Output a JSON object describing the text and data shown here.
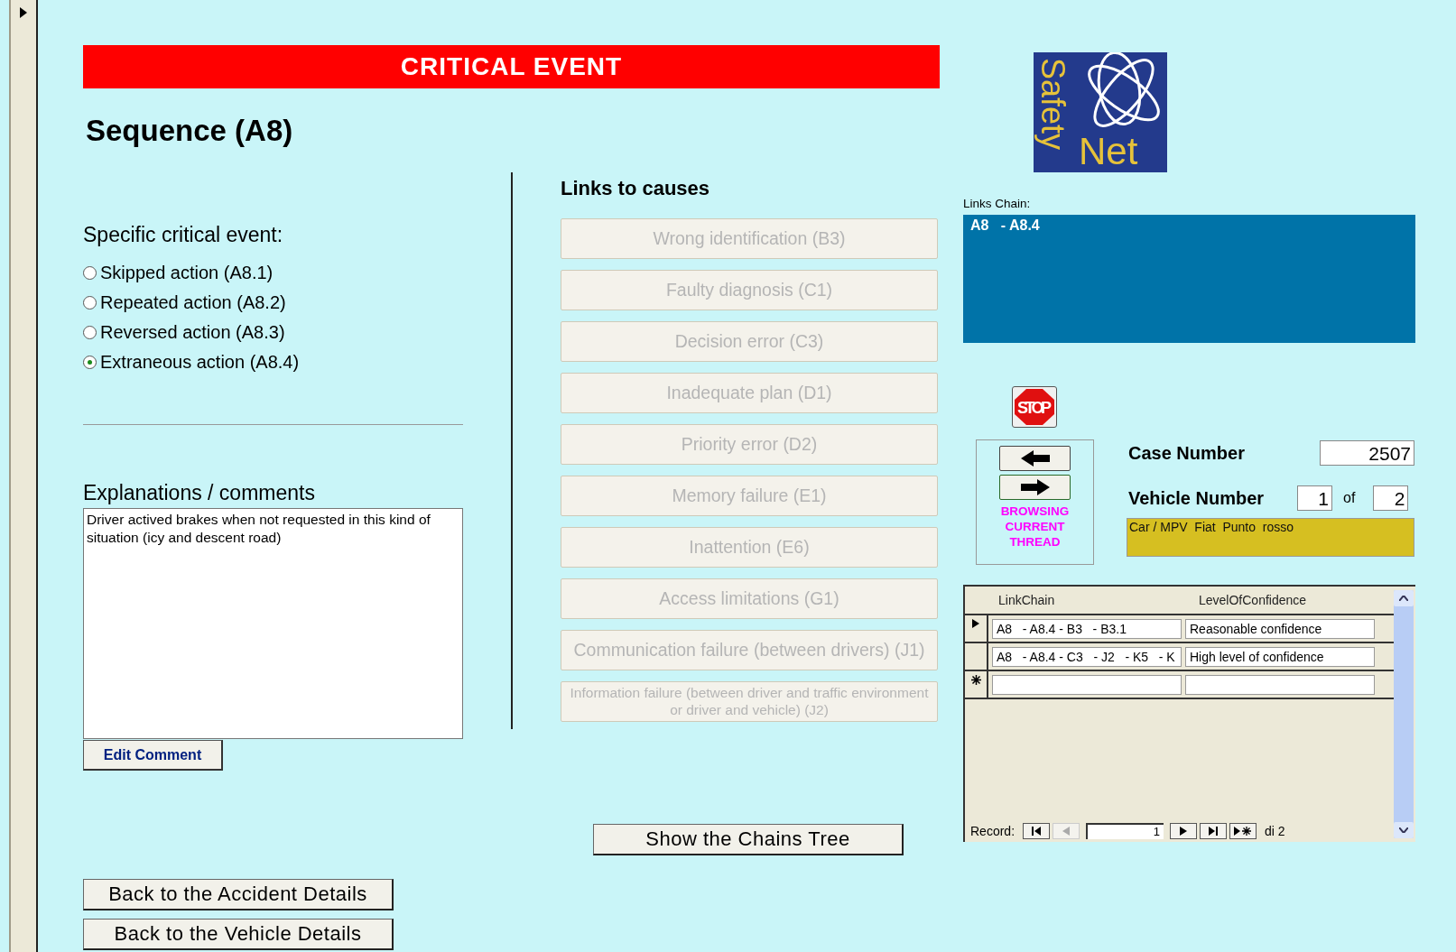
{
  "banner": {
    "title": "CRITICAL EVENT"
  },
  "heading": "Sequence (A8)",
  "logo": {
    "word_1": "Safety",
    "word_2": "Net"
  },
  "specific_event": {
    "label": "Specific critical event:",
    "options": [
      {
        "label": "Skipped action (A8.1)",
        "selected": false
      },
      {
        "label": "Repeated action (A8.2)",
        "selected": false
      },
      {
        "label": "Reversed action (A8.3)",
        "selected": false
      },
      {
        "label": "Extraneous action (A8.4)",
        "selected": true
      }
    ]
  },
  "comments": {
    "label": "Explanations / comments",
    "value": "Driver actived brakes when not requested in this kind of situation (icy and descent road)",
    "button": "Edit Comment"
  },
  "causes": {
    "title": "Links to causes",
    "buttons": [
      {
        "label": "Wrong identification (B3)",
        "disabled": true
      },
      {
        "label": "Faulty diagnosis (C1)",
        "disabled": true
      },
      {
        "label": "Decision error (C3)",
        "disabled": true
      },
      {
        "label": "Inadequate plan (D1)",
        "disabled": true
      },
      {
        "label": "Priority error (D2)",
        "disabled": true
      },
      {
        "label": "Memory failure (E1)",
        "disabled": true
      },
      {
        "label": "Inattention (E6)",
        "disabled": true
      },
      {
        "label": "Access limitations (G1)",
        "disabled": true
      },
      {
        "label": "Communication failure (between drivers) (J1)",
        "disabled": true
      },
      {
        "label": "Information failure (between driver and traffic environment or driver and vehicle) (J2)",
        "disabled": true
      }
    ],
    "tree_button": "Show the Chains Tree"
  },
  "back_buttons": [
    "Back to the Accident Details",
    "Back to the Vehicle Details"
  ],
  "links_chain": {
    "label": "Links Chain:",
    "value": "A8   - A8.4"
  },
  "stop_button": "STOP",
  "browse": {
    "caption": "BROWSING CURRENT THREAD"
  },
  "case_number": {
    "label": "Case Number",
    "value": "2507"
  },
  "vehicle": {
    "label": "Vehicle Number",
    "value": "1",
    "of": "of",
    "total": "2",
    "description": "Car / MPV  Fiat  Punto  rosso"
  },
  "subform": {
    "columns": [
      "LinkChain",
      "LevelOfConfidence"
    ],
    "rows": [
      {
        "kind": "record",
        "current": true,
        "cells": [
          "A8   - A8.4 - B3   - B3.1",
          "Reasonable confidence"
        ]
      },
      {
        "kind": "record",
        "current": false,
        "cells": [
          "A8   - A8.4 - C3   - J2   - K5   - K",
          "High level of confidence"
        ]
      },
      {
        "kind": "new"
      }
    ],
    "navigator": {
      "label": "Record:",
      "value": "1",
      "total": "di 2"
    }
  }
}
